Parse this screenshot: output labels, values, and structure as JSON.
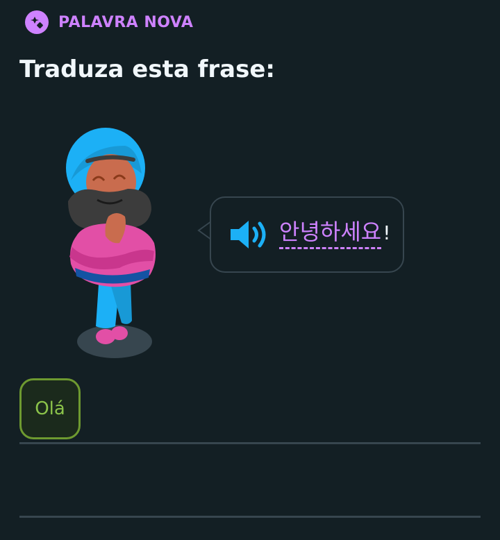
{
  "header": {
    "badge_label": "PALAVRA NOVA",
    "badge_icon": "puzzle-sparkle-icon"
  },
  "prompt": {
    "title": "Traduza esta frase:"
  },
  "speech": {
    "icon": "speaker-icon",
    "word": "안녕하세요",
    "punctuation": "!"
  },
  "answer": {
    "chips": [
      {
        "label": "Olá"
      }
    ]
  },
  "colors": {
    "background": "#131f24",
    "accent": "#ce82ff",
    "speaker": "#1cb0f6",
    "chip_border": "#6e9a30",
    "chip_text": "#8bc34a",
    "divider": "#37464f"
  }
}
